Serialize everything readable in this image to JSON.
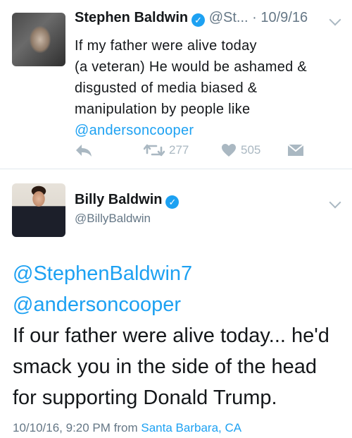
{
  "tweet1": {
    "name": "Stephen Baldwin",
    "handle": "@St...",
    "date": "· 10/9/16",
    "text_lines": [
      "If my father were alive today",
      "(a veteran) He would be ashamed &",
      "disgusted of media biased &",
      "manipulation by people like"
    ],
    "mention": "@andersoncooper",
    "retweet_count": "277",
    "like_count": "505"
  },
  "tweet2": {
    "name": "Billy Baldwin",
    "handle": "@BillyBaldwin",
    "mention1": "@StephenBaldwin7",
    "mention2": "@andersoncooper",
    "text_lines": [
      "If our father were alive today... he'd",
      "smack you in the side of the head",
      "for supporting Donald Trump."
    ],
    "timestamp": "10/10/16, 9:20 PM from",
    "location": "Santa Barbara, CA"
  },
  "colors": {
    "accent": "#1da1f2",
    "muted": "#657786",
    "icon": "#aab8c2",
    "text": "#14171a"
  },
  "icons": {
    "verified": "verified-badge-icon",
    "reply": "reply-icon",
    "retweet": "retweet-icon",
    "like": "heart-icon",
    "dm": "envelope-icon",
    "caret": "chevron-down-icon"
  }
}
